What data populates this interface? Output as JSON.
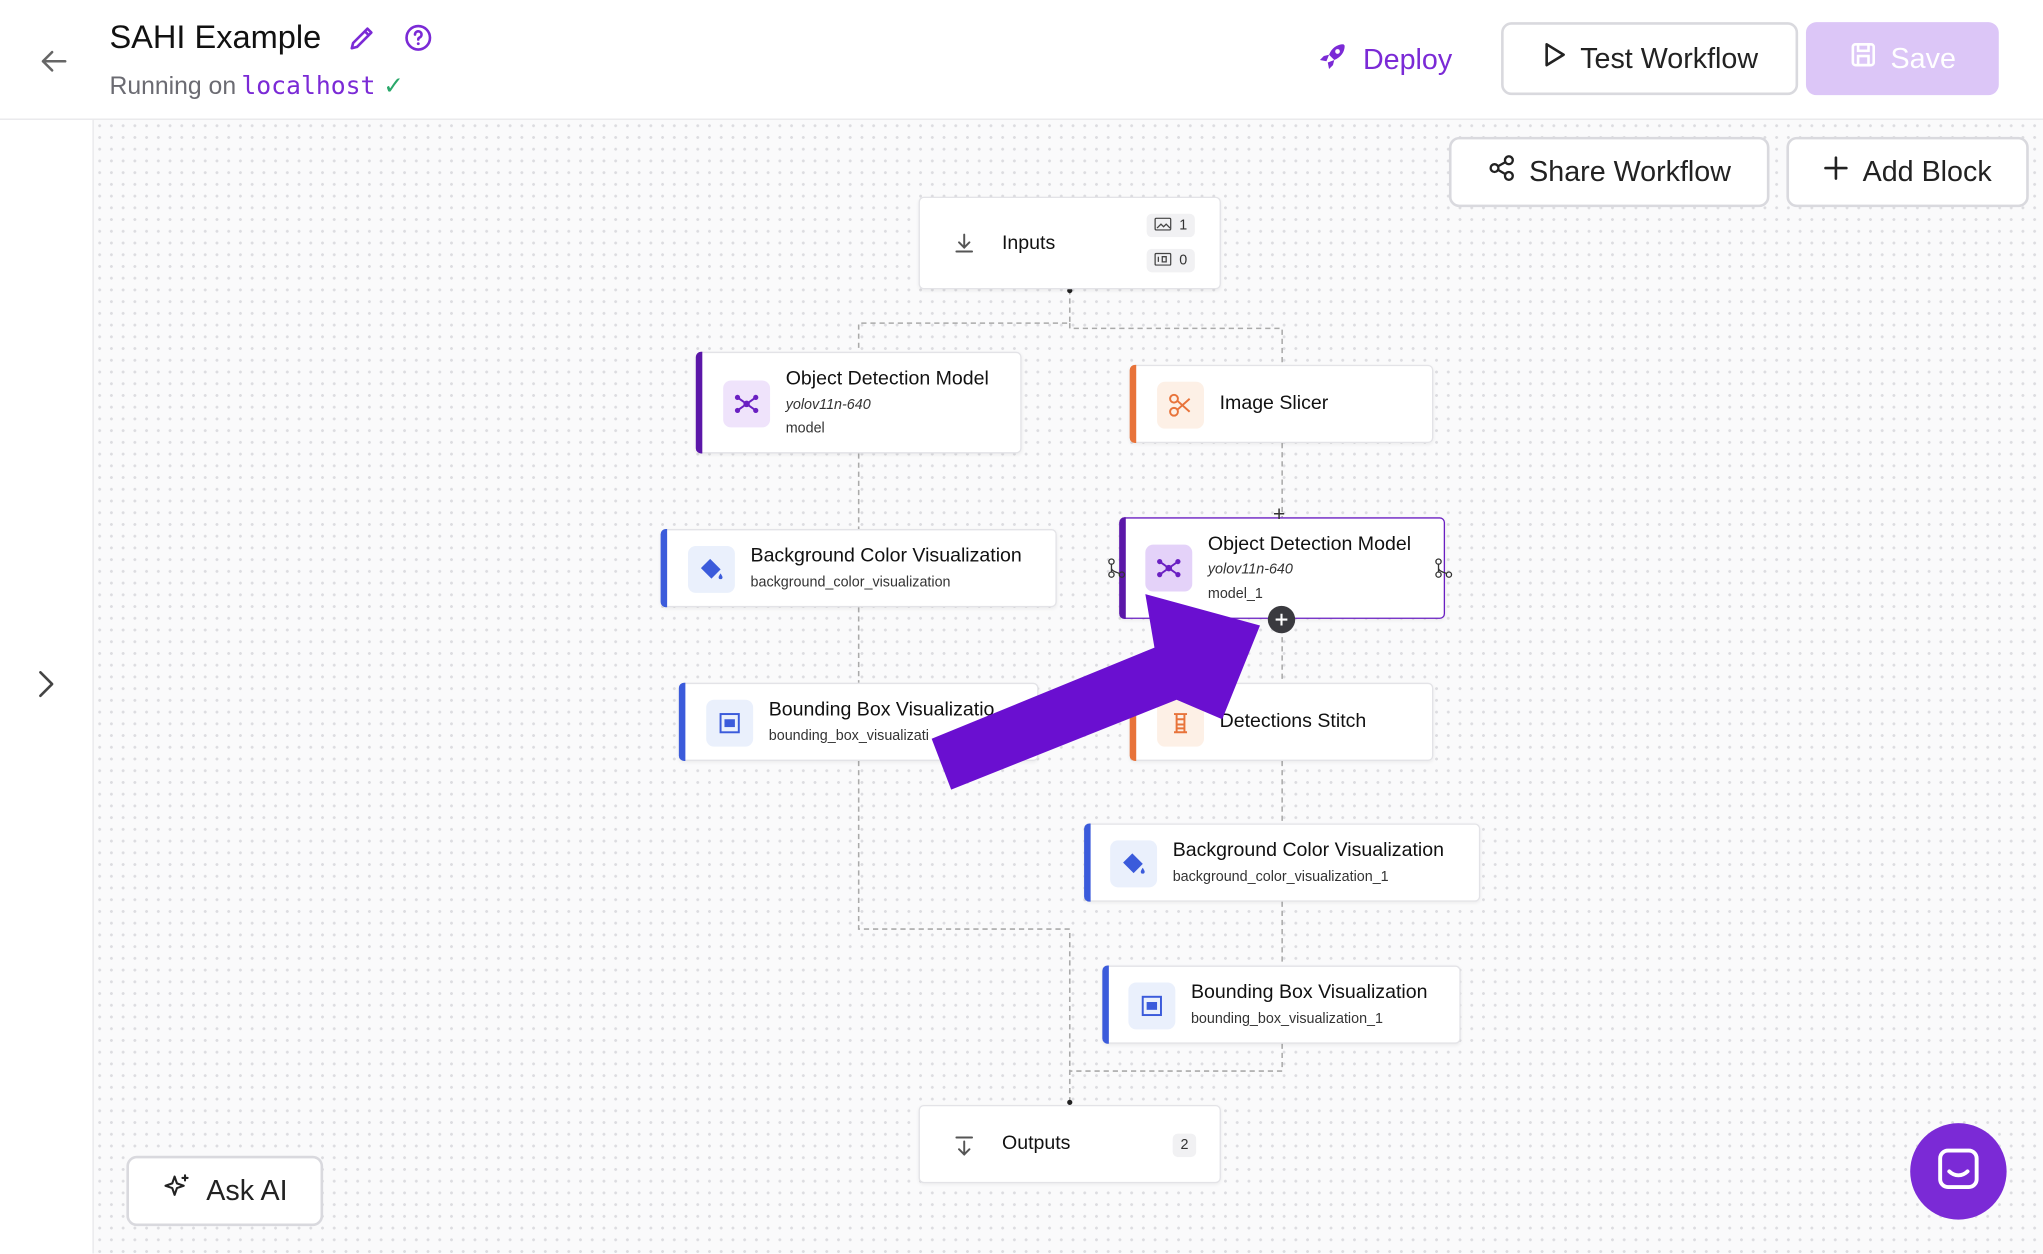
{
  "header": {
    "title": "SAHI Example",
    "running_prefix": "Running on",
    "host": "localhost",
    "deploy_label": "Deploy",
    "test_label": "Test Workflow",
    "save_label": "Save"
  },
  "canvas": {
    "share_label": "Share Workflow",
    "add_block_label": "Add Block",
    "ask_ai_label": "Ask AI"
  },
  "nodes": {
    "inputs": {
      "title": "Inputs",
      "images_count": "1",
      "params_count": "0"
    },
    "od1": {
      "title": "Object Detection Model",
      "model": "yolov11n-640",
      "name": "model"
    },
    "slicer": {
      "title": "Image Slicer"
    },
    "bgviz1": {
      "title": "Background Color Visualization",
      "name": "background_color_visualization"
    },
    "od2": {
      "title": "Object Detection Model",
      "model": "yolov11n-640",
      "name": "model_1"
    },
    "bbviz1": {
      "title": "Bounding Box Visualizatio",
      "name": "bounding_box_visualizati"
    },
    "stitch": {
      "title": "Detections Stitch"
    },
    "bgviz2": {
      "title": "Background Color Visualization",
      "name": "background_color_visualization_1"
    },
    "bbviz2": {
      "title": "Bounding Box Visualization",
      "name": "bounding_box_visualization_1"
    },
    "outputs": {
      "title": "Outputs",
      "count": "2"
    }
  },
  "colors": {
    "accent_purple": "#7b2ad6",
    "model_accent": "#5b17a8",
    "viz_accent": "#3b5bdb",
    "transform_accent": "#e8733a",
    "arrow": "#6a0fd0"
  }
}
